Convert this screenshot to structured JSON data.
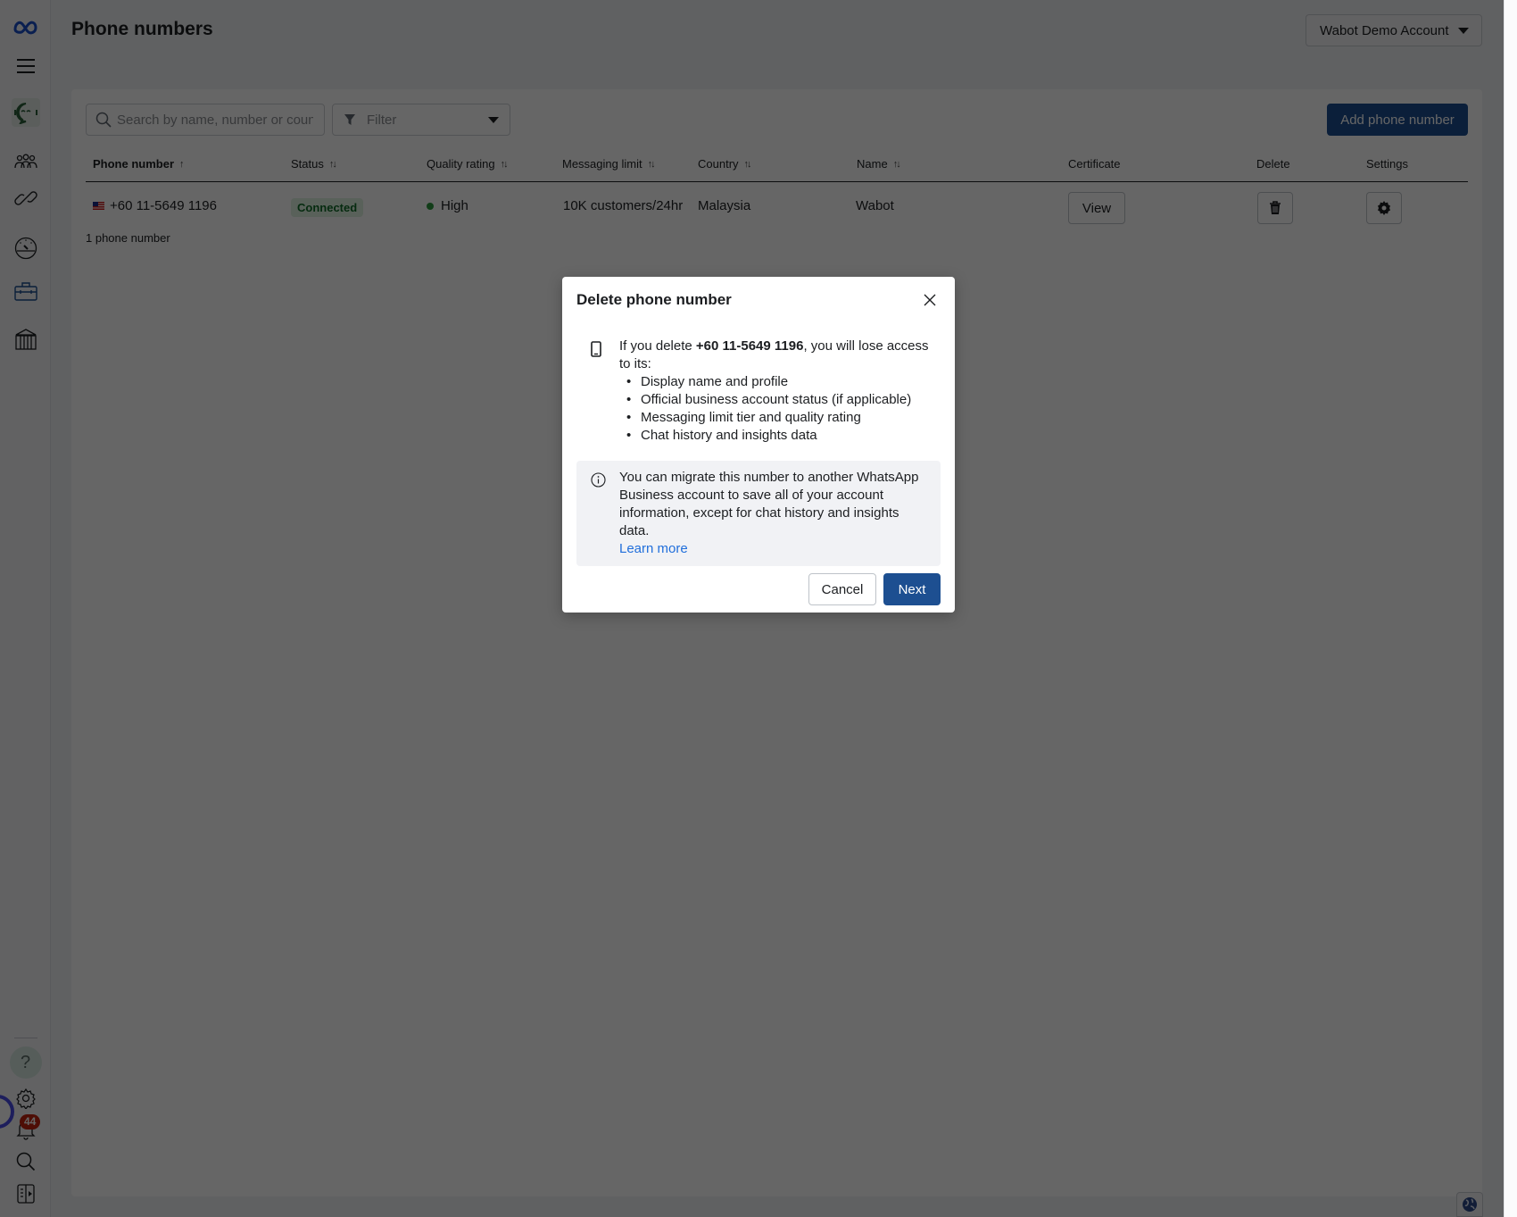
{
  "page": {
    "title": "Phone numbers",
    "account_selector": "Wabot Demo Account"
  },
  "sidebar": {
    "items": [
      {
        "name": "meta-logo"
      },
      {
        "name": "menu"
      },
      {
        "name": "wabot-app"
      },
      {
        "name": "people"
      },
      {
        "name": "links"
      },
      {
        "name": "dashboard"
      },
      {
        "name": "business-tools"
      },
      {
        "name": "institution"
      },
      {
        "name": "help",
        "label": "?"
      },
      {
        "name": "settings"
      },
      {
        "name": "notifications"
      },
      {
        "name": "search"
      },
      {
        "name": "panel"
      }
    ],
    "notification_count": "44",
    "active_color": "#1d4f91"
  },
  "toolbar": {
    "search_placeholder": "Search by name, number or country",
    "filter_label": "Filter",
    "add_button": "Add phone number"
  },
  "table": {
    "columns": [
      {
        "label": "Phone number",
        "sort": "asc"
      },
      {
        "label": "Status",
        "sort": "both"
      },
      {
        "label": "Quality rating",
        "sort": "both"
      },
      {
        "label": "Messaging limit",
        "sort": "both"
      },
      {
        "label": "Country",
        "sort": "both"
      },
      {
        "label": "Name",
        "sort": "both"
      },
      {
        "label": "Certificate"
      },
      {
        "label": "Delete"
      },
      {
        "label": "Settings"
      }
    ],
    "rows": [
      {
        "phone": "+60 11-5649 1196",
        "status": "Connected",
        "quality": "High",
        "messaging_limit": "10K customers/24hr",
        "country": "Malaysia",
        "name": "Wabot",
        "certificate_button": "View"
      }
    ],
    "count_text": "1 phone number"
  },
  "modal": {
    "title": "Delete phone number",
    "intro_prefix": "If you delete ",
    "intro_number": "+60 11-5649 1196",
    "intro_suffix": ", you will lose access to its:",
    "items": [
      "Display name and profile",
      "Official business account status (if applicable)",
      "Messaging limit tier and quality rating",
      "Chat history and insights data"
    ],
    "info_text": "You can migrate this number to another WhatsApp Business account to save all of your account information, except for chat history and insights data.",
    "learn_more": "Learn more",
    "cancel": "Cancel",
    "next": "Next"
  },
  "colors": {
    "primary": "#1d4f91",
    "status_connected_bg": "#dff2e1",
    "status_connected_text": "#116b29",
    "quality_high": "#2b9a3e",
    "badge": "#c3240f",
    "link": "#216fdb"
  }
}
